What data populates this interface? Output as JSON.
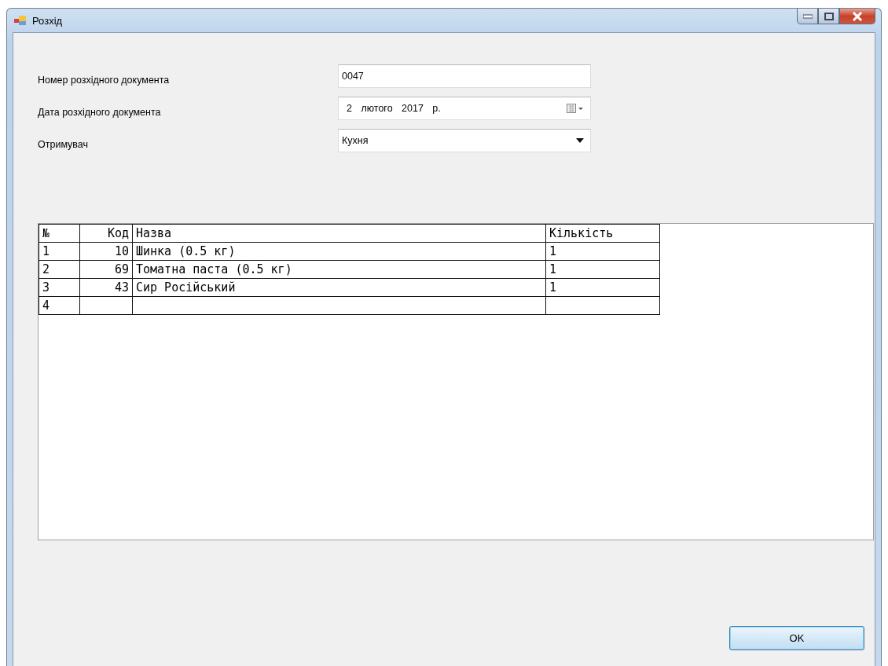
{
  "window": {
    "title": "Розхід"
  },
  "form": [
    {
      "kind": "text",
      "label": "Номер розхідного документа",
      "value": "0047"
    },
    {
      "kind": "date",
      "label": "Дата розхідного документа",
      "value": "2 лютого 2017 р."
    },
    {
      "kind": "combo",
      "label": "Отримувач",
      "value": "Кухня"
    }
  ],
  "table": {
    "columns": [
      "№",
      "Код",
      "Назва",
      "Кількість"
    ],
    "rows": [
      [
        "1",
        "10",
        "Шинка (0.5 кг)",
        "1"
      ],
      [
        "2",
        "69",
        "Томатна паста (0.5 кг)",
        "1"
      ],
      [
        "3",
        "43",
        "Сир Російський",
        "1"
      ],
      [
        "4"
      ]
    ]
  },
  "buttons": [
    "OK"
  ]
}
